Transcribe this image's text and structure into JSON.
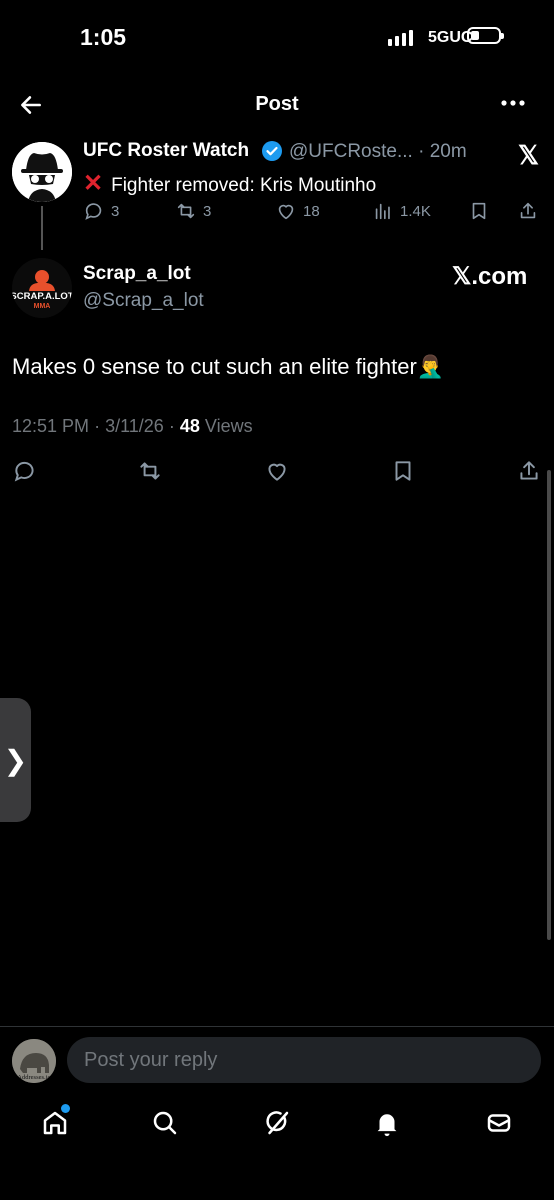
{
  "status_bar": {
    "time": "1:05",
    "network": "5GUC",
    "battery_level": 0.25
  },
  "header": {
    "title": "Post"
  },
  "quoted_post": {
    "author_name": "UFC Roster Watch",
    "handle": "@UFCRoste...",
    "separator": "·",
    "time_ago": "20m",
    "text": "Fighter removed: Kris Moutinho",
    "replies": "3",
    "reposts": "3",
    "likes": "18",
    "views": "1.4K",
    "platform_badge": "𝕏"
  },
  "post": {
    "author_name": "Scrap_a_lot",
    "handle": "@Scrap_a_lot",
    "platform": "𝕏.com",
    "avatar_text": "SCRAP.A.LOT",
    "avatar_subtext": "MMA",
    "text": "Makes 0 sense to cut such an elite fighter🤦‍♂️",
    "time": "12:51 PM",
    "date": "3/11/26",
    "views_count": "48",
    "views_label": "Views",
    "dot": "·"
  },
  "reply": {
    "placeholder": "Post your reply",
    "avatar_caption": "Addresses.io"
  },
  "side_handle": {
    "glyph": "❯"
  },
  "icons": {
    "back": "arrow-left-icon",
    "more": "more-horizontal-icon",
    "reply": "reply-icon",
    "repost": "repost-icon",
    "like": "heart-icon",
    "views": "views-icon",
    "bookmark": "bookmark-icon",
    "share": "share-icon",
    "home": "home-icon",
    "search": "search-icon",
    "grok": "grok-icon",
    "notifications": "bell-icon",
    "messages": "mail-icon"
  },
  "colors": {
    "background": "#000000",
    "accent": "#1d9bf0",
    "muted": "#71767b",
    "cross": "#e0232e",
    "avatar_brand": "#e8502c"
  }
}
